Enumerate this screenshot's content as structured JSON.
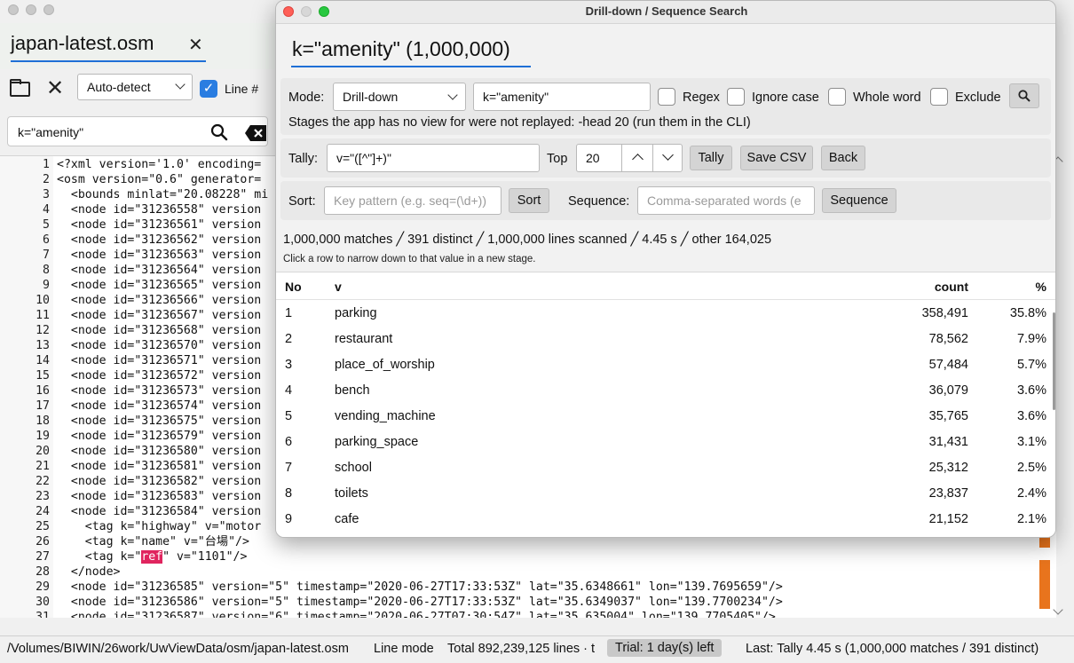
{
  "main": {
    "file_tab": "japan-latest.osm",
    "encoding": "Auto-detect",
    "line_numbers_label": "Line #",
    "search_value": "k=\"amenity\"",
    "code_lines": [
      {
        "num": "1",
        "text": "<?xml version='1.0' encoding="
      },
      {
        "num": "2",
        "text": "<osm version=\"0.6\" generator="
      },
      {
        "num": "3",
        "text": "  <bounds minlat=\"20.08228\" mi"
      },
      {
        "num": "4",
        "text": "  <node id=\"31236558\" version"
      },
      {
        "num": "5",
        "text": "  <node id=\"31236561\" version"
      },
      {
        "num": "6",
        "text": "  <node id=\"31236562\" version"
      },
      {
        "num": "7",
        "text": "  <node id=\"31236563\" version"
      },
      {
        "num": "8",
        "text": "  <node id=\"31236564\" version"
      },
      {
        "num": "9",
        "text": "  <node id=\"31236565\" version"
      },
      {
        "num": "10",
        "text": "  <node id=\"31236566\" version"
      },
      {
        "num": "11",
        "text": "  <node id=\"31236567\" version"
      },
      {
        "num": "12",
        "text": "  <node id=\"31236568\" version"
      },
      {
        "num": "13",
        "text": "  <node id=\"31236570\" version"
      },
      {
        "num": "14",
        "text": "  <node id=\"31236571\" version"
      },
      {
        "num": "15",
        "text": "  <node id=\"31236572\" version"
      },
      {
        "num": "16",
        "text": "  <node id=\"31236573\" version"
      },
      {
        "num": "17",
        "text": "  <node id=\"31236574\" version"
      },
      {
        "num": "18",
        "text": "  <node id=\"31236575\" version"
      },
      {
        "num": "19",
        "text": "  <node id=\"31236579\" version"
      },
      {
        "num": "20",
        "text": "  <node id=\"31236580\" version"
      },
      {
        "num": "21",
        "text": "  <node id=\"31236581\" version"
      },
      {
        "num": "22",
        "text": "  <node id=\"31236582\" version"
      },
      {
        "num": "23",
        "text": "  <node id=\"31236583\" version"
      },
      {
        "num": "24",
        "text": "  <node id=\"31236584\" version"
      },
      {
        "num": "25",
        "text": "    <tag k=\"highway\" v=\"motor"
      },
      {
        "num": "26",
        "text": "    <tag k=\"name\" v=\"台場\"/>"
      },
      {
        "num": "27",
        "pre": "    <tag k=\"",
        "hl": "ref",
        "post": "\" v=\"1101\"/>"
      },
      {
        "num": "28",
        "text": "  </node>"
      },
      {
        "num": "29",
        "text": "  <node id=\"31236585\" version=\"5\" timestamp=\"2020-06-27T17:33:53Z\" lat=\"35.6348661\" lon=\"139.7695659\"/>"
      },
      {
        "num": "30",
        "text": "  <node id=\"31236586\" version=\"5\" timestamp=\"2020-06-27T17:33:53Z\" lat=\"35.6349037\" lon=\"139.7700234\"/>"
      },
      {
        "num": "31",
        "text": "  <node id=\"31236587\" version=\"6\" timestamp=\"2020-06-27T07:30:54Z\" lat=\"35.635004\" lon=\"139.7705405\"/>"
      }
    ],
    "status": {
      "path": "/Volumes/BIWIN/26work/UwViewData/osm/japan-latest.osm",
      "mode": "Line mode",
      "total": "Total 892,239,125 lines · t",
      "trial": "Trial: 1 day(s) left",
      "last": "Last: Tally 4.45 s  (1,000,000 matches / 391 distinct)"
    }
  },
  "dialog": {
    "title": "Drill-down / Sequence Search",
    "stage_tab": "k=\"amenity\" (1,000,000)",
    "mode_label": "Mode:",
    "mode_value": "Drill-down",
    "query_value": "k=\"amenity\"",
    "options": [
      "Regex",
      "Ignore case",
      "Whole word",
      "Exclude"
    ],
    "replay_note": "Stages the app has no view for were not replayed: -head 20 (run them in the CLI)",
    "tally_label": "Tally:",
    "tally_value": "v=\"([^\"]+)\"",
    "top_label": "Top",
    "top_value": "20",
    "tally_button": "Tally",
    "save_csv_button": "Save CSV",
    "back_button": "Back",
    "sort_label": "Sort:",
    "sort_placeholder": "Key pattern (e.g. seq=(\\d+))",
    "sort_button": "Sort",
    "sequence_label": "Sequence:",
    "sequence_placeholder": "Comma-separated words (e",
    "sequence_button": "Sequence",
    "summary": "1,000,000 matches ╱ 391 distinct ╱ 1,000,000 lines scanned ╱ 4.45 s ╱ other 164,025",
    "hint": "Click a row to narrow down to that value in a new stage.",
    "columns": {
      "no": "No",
      "v": "v",
      "count": "count",
      "pct": "%"
    },
    "rows": [
      {
        "no": "1",
        "v": "parking",
        "count": "358,491",
        "pct": "35.8%"
      },
      {
        "no": "2",
        "v": "restaurant",
        "count": "78,562",
        "pct": "7.9%"
      },
      {
        "no": "3",
        "v": "place_of_worship",
        "count": "57,484",
        "pct": "5.7%"
      },
      {
        "no": "4",
        "v": "bench",
        "count": "36,079",
        "pct": "3.6%"
      },
      {
        "no": "5",
        "v": "vending_machine",
        "count": "35,765",
        "pct": "3.6%"
      },
      {
        "no": "6",
        "v": "parking_space",
        "count": "31,431",
        "pct": "3.1%"
      },
      {
        "no": "7",
        "v": "school",
        "count": "25,312",
        "pct": "2.5%"
      },
      {
        "no": "8",
        "v": "toilets",
        "count": "23,837",
        "pct": "2.4%"
      },
      {
        "no": "9",
        "v": "cafe",
        "count": "21,152",
        "pct": "2.1%"
      }
    ]
  },
  "colors": {
    "accent": "#2a7de1",
    "highlight": "#e0245e",
    "minimap": "#e8741d"
  }
}
